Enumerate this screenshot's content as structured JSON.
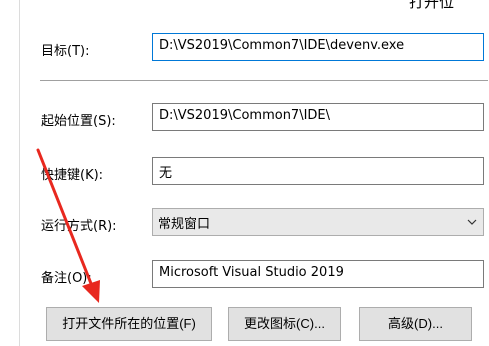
{
  "corner_text": "打开位",
  "target": {
    "label": "目标(T):",
    "value": "D:\\VS2019\\Common7\\IDE\\devenv.exe"
  },
  "start_in": {
    "label": "起始位置(S):",
    "value": "D:\\VS2019\\Common7\\IDE\\"
  },
  "shortcut_key": {
    "label": "快捷键(K):",
    "value": "无"
  },
  "run": {
    "label": "运行方式(R):",
    "selected": "常规窗口"
  },
  "comment": {
    "label": "备注(O):",
    "value": "Microsoft Visual Studio 2019"
  },
  "buttons": {
    "open_location": "打开文件所在的位置(F)",
    "change_icon": "更改图标(C)...",
    "advanced": "高级(D)..."
  },
  "colors": {
    "focus_border": "#0078d7",
    "annotation_arrow": "#e8281f"
  },
  "icons": {
    "dropdown": "chevron-down-icon",
    "annotation": "red-arrow-annotation"
  }
}
